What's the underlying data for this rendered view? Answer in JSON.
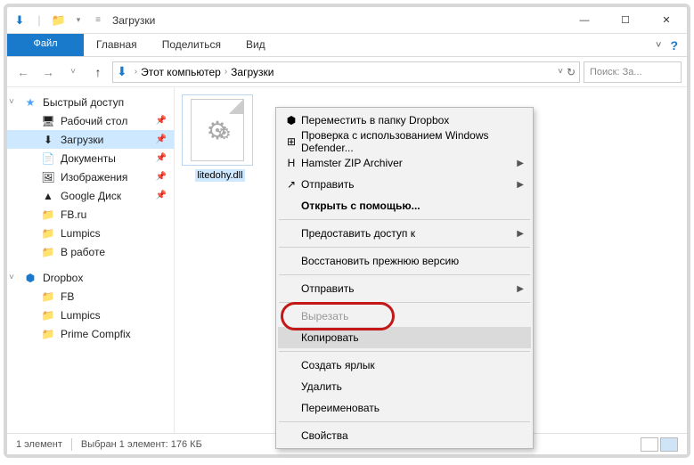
{
  "titlebar": {
    "title": "Загрузки"
  },
  "winctrl": {
    "min": "—",
    "max": "☐",
    "close": "✕"
  },
  "tabs": {
    "file": "Файл",
    "home": "Главная",
    "share": "Поделиться",
    "view": "Вид"
  },
  "ribbon_right": {
    "expand": "˅",
    "help": "?"
  },
  "nav": {
    "back": "←",
    "fwd": "→",
    "recent": "˅",
    "up": "↑"
  },
  "address": {
    "root": "Этот компьютер",
    "sep": "›",
    "folder": "Загрузки",
    "refresh": "↻",
    "dropdown": "˅"
  },
  "search": {
    "placeholder": "Поиск: За..."
  },
  "sidebar": {
    "quick": {
      "label": "Быстрый доступ",
      "icon": "★"
    },
    "quick_items": [
      {
        "label": "Рабочий стол",
        "icon": "🖥",
        "pinned": true
      },
      {
        "label": "Загрузки",
        "icon": "⬇",
        "pinned": true,
        "selected": true
      },
      {
        "label": "Документы",
        "icon": "📄",
        "pinned": true
      },
      {
        "label": "Изображения",
        "icon": "🖼",
        "pinned": true
      },
      {
        "label": "Google Диск",
        "icon": "▲",
        "pinned": true
      },
      {
        "label": "FB.ru",
        "icon": "📁"
      },
      {
        "label": "Lumpics",
        "icon": "📁"
      },
      {
        "label": "В работе",
        "icon": "📁"
      }
    ],
    "dropbox": {
      "label": "Dropbox",
      "icon": "⬢"
    },
    "dropbox_items": [
      {
        "label": "FB",
        "icon": "📁"
      },
      {
        "label": "Lumpics",
        "icon": "📁"
      },
      {
        "label": "Prime Compfix",
        "icon": "📁"
      }
    ]
  },
  "file": {
    "name": "litedohy.dll",
    "gear": "⚙"
  },
  "context_menu": {
    "items": [
      {
        "label": "Переместить в папку Dropbox",
        "icon": "⬢"
      },
      {
        "label": "Проверка с использованием Windows Defender...",
        "icon": "⊞"
      },
      {
        "label": "Hamster ZIP Archiver",
        "icon": "H",
        "submenu": true
      },
      {
        "label": "Отправить",
        "icon": "↗",
        "submenu": true
      },
      {
        "label": "Открыть с помощью...",
        "bold": true
      },
      {
        "sep": true
      },
      {
        "label": "Предоставить доступ к",
        "submenu": true
      },
      {
        "sep": true
      },
      {
        "label": "Восстановить прежнюю версию"
      },
      {
        "sep": true
      },
      {
        "label": "Отправить",
        "submenu": true
      },
      {
        "sep": true
      },
      {
        "label": "Вырезать",
        "disabled": true
      },
      {
        "label": "Копировать",
        "highlight": true
      },
      {
        "sep": true
      },
      {
        "label": "Создать ярлык"
      },
      {
        "label": "Удалить"
      },
      {
        "label": "Переименовать"
      },
      {
        "sep": true
      },
      {
        "label": "Свойства"
      }
    ]
  },
  "statusbar": {
    "count": "1 элемент",
    "selected": "Выбран 1 элемент: 176 КБ"
  }
}
